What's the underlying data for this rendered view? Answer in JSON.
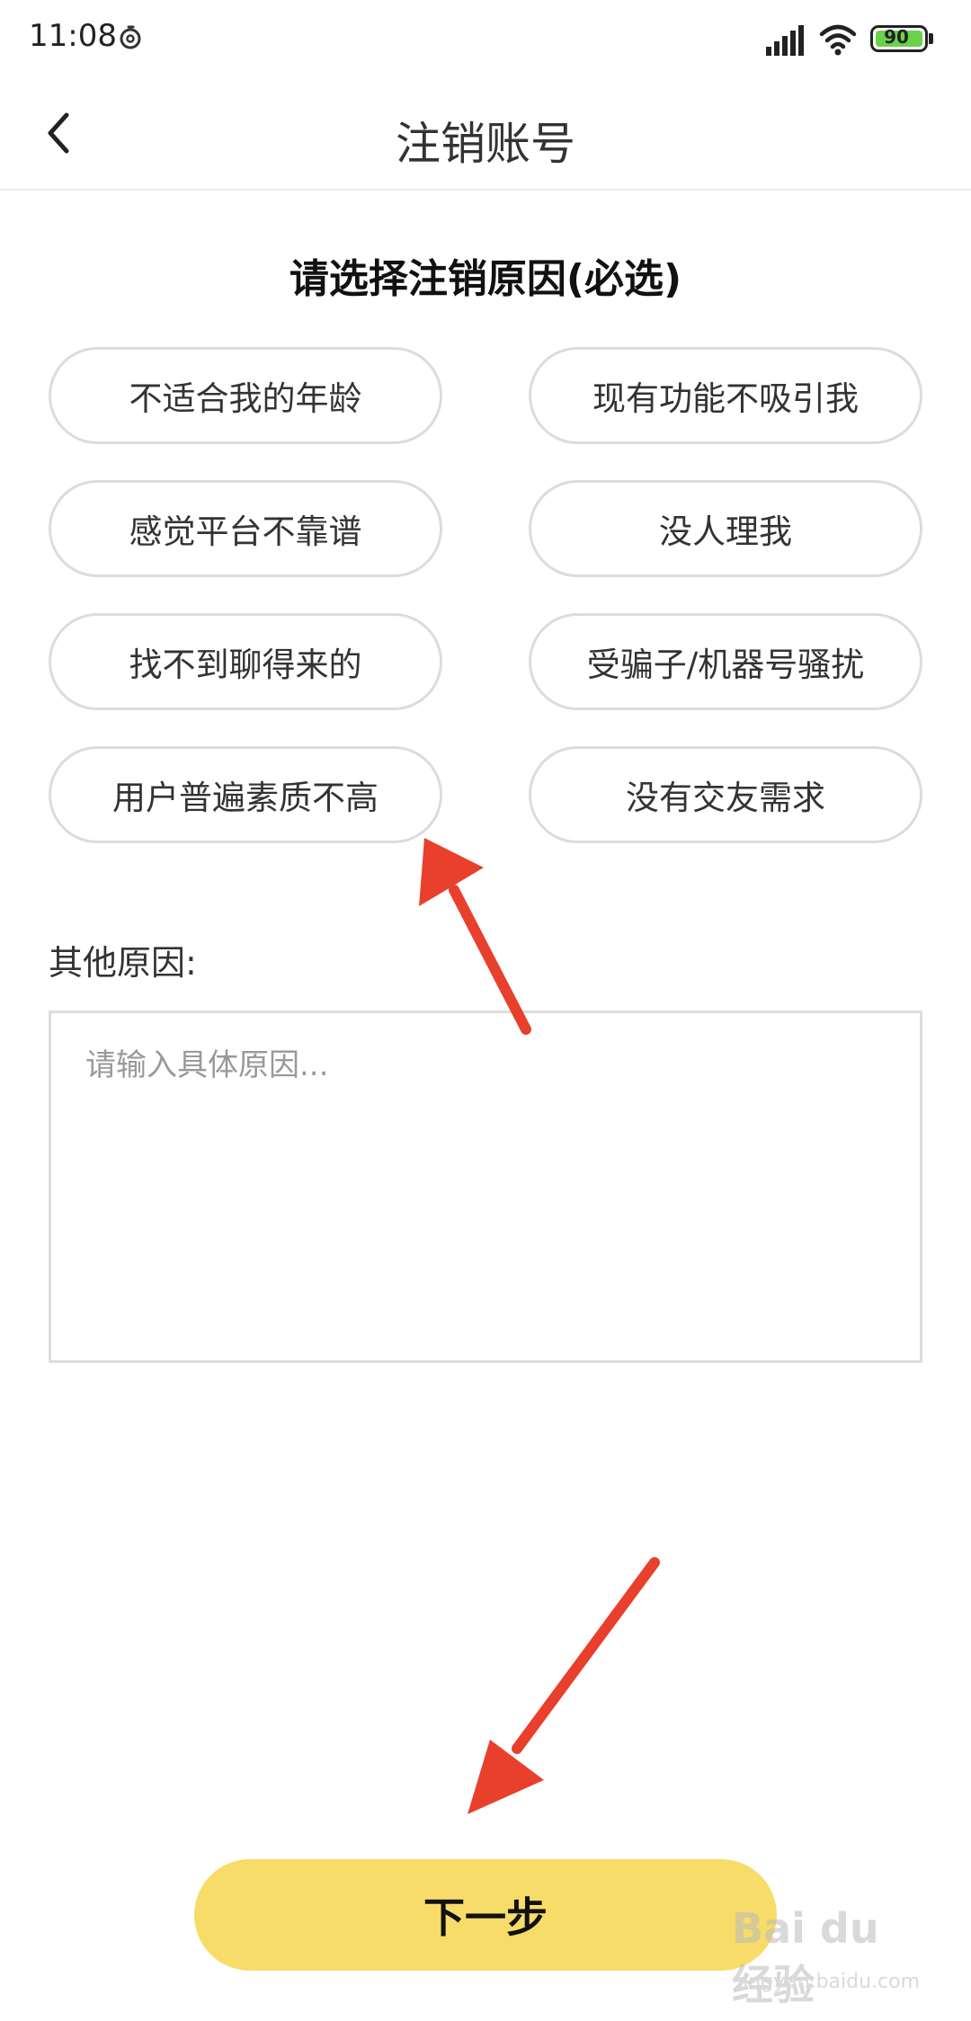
{
  "status_bar": {
    "time": "11:08",
    "battery_level": "90",
    "icons": [
      "app-notification-icon",
      "signal-icon",
      "wifi-icon",
      "battery-icon"
    ]
  },
  "nav": {
    "back_icon": "chevron-left-icon",
    "title": "注销账号"
  },
  "section": {
    "title": "请选择注销原因(必选)"
  },
  "reasons": [
    {
      "label": "不适合我的年龄"
    },
    {
      "label": "现有功能不吸引我"
    },
    {
      "label": "感觉平台不靠谱"
    },
    {
      "label": "没人理我"
    },
    {
      "label": "找不到聊得来的"
    },
    {
      "label": "受骗子/机器号骚扰"
    },
    {
      "label": "用户普遍素质不高"
    },
    {
      "label": "没有交友需求"
    }
  ],
  "other": {
    "label": "其他原因:",
    "placeholder": "请输入具体原因...",
    "value": ""
  },
  "next_button": {
    "label": "下一步"
  },
  "colors": {
    "accent": "#f7dc6a",
    "battery_fill": "#6ad14a",
    "annotation_arrow": "#e8402c",
    "chip_border": "#dcdcdc"
  },
  "watermark": {
    "logo": "Bai du 经验",
    "url": "jingyan.baidu.com"
  }
}
